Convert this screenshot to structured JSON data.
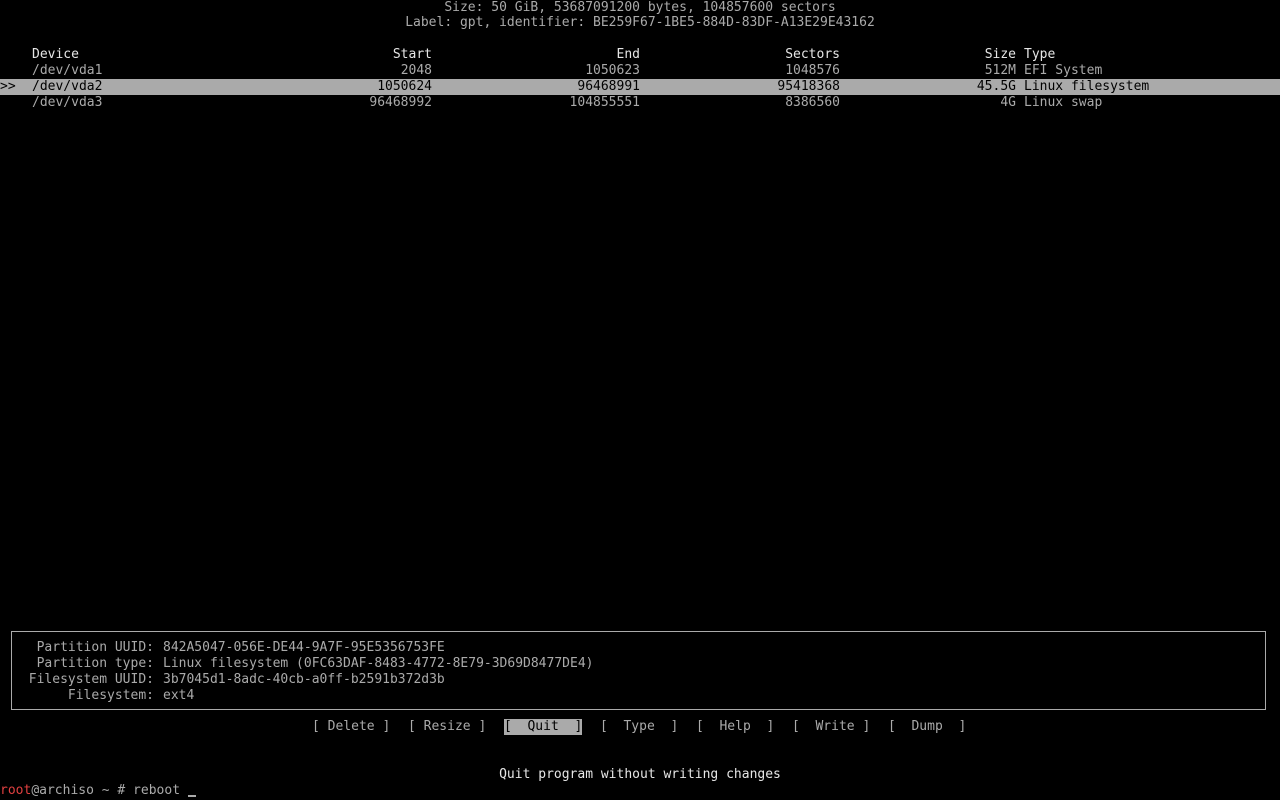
{
  "disk": {
    "size_line": "Size: 50 GiB, 53687091200 bytes, 104857600 sectors",
    "label_line": "Label: gpt, identifier: BE259F67-1BE5-884D-83DF-A13E29E43162"
  },
  "table": {
    "headers": {
      "device": "Device",
      "start": "Start",
      "end": "End",
      "sectors": "Sectors",
      "size": "Size",
      "type": "Type"
    },
    "selection_marker": ">>",
    "rows": [
      {
        "device": "/dev/vda1",
        "start": "2048",
        "end": "1050623",
        "sectors": "1048576",
        "size": "512M",
        "type": "EFI System"
      },
      {
        "device": "/dev/vda2",
        "start": "1050624",
        "end": "96468991",
        "sectors": "95418368",
        "size": "45.5G",
        "type": "Linux filesystem"
      },
      {
        "device": "/dev/vda3",
        "start": "96468992",
        "end": "104855551",
        "sectors": "8386560",
        "size": "4G",
        "type": "Linux swap"
      }
    ]
  },
  "info": {
    "partition_uuid_key": "Partition UUID:",
    "partition_uuid_val": "842A5047-056E-DE44-9A7F-95E5356753FE",
    "partition_type_key": "Partition type:",
    "partition_type_val": "Linux filesystem (0FC63DAF-8483-4772-8E79-3D69D8477DE4)",
    "filesystem_uuid_key": "Filesystem UUID:",
    "filesystem_uuid_val": "3b7045d1-8adc-40cb-a0ff-b2591b372d3b",
    "filesystem_key": "Filesystem:",
    "filesystem_val": "ext4"
  },
  "menu": {
    "delete": "[ Delete ]",
    "resize": "[ Resize ]",
    "quit": "[  Quit  ]",
    "type": "[  Type  ]",
    "help": "[  Help  ]",
    "write": "[  Write ]",
    "dump": "[  Dump  ]"
  },
  "hint": "Quit program without writing changes",
  "prompt": {
    "user": "root",
    "rest": "@archiso ~ # reboot "
  },
  "colors": {
    "foreground": "#aaaaaa",
    "bright": "#e6e6e6",
    "highlight_bg": "#aaaaaa",
    "background": "#000000",
    "prompt_user": "#e04040"
  }
}
